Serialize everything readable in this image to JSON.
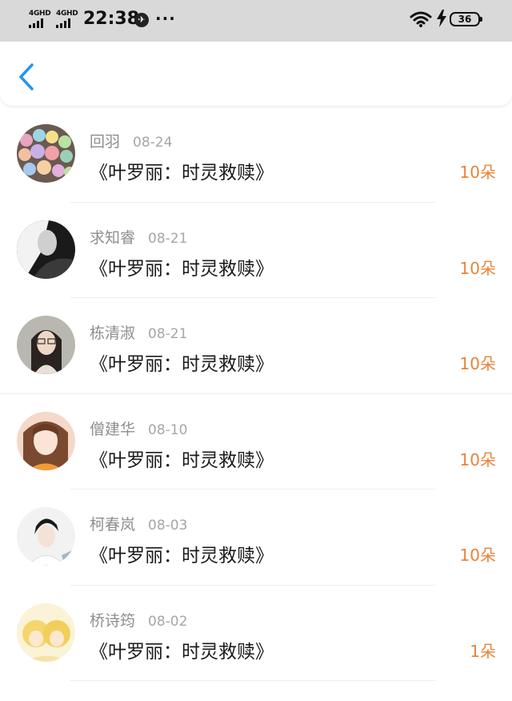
{
  "status_bar": {
    "network_1": "4GHD",
    "network_2": "4GHD",
    "time": "22:38",
    "more": "···",
    "battery": "36"
  },
  "records": [
    {
      "name": "回羽",
      "date": "08-24",
      "title": "《叶罗丽：时灵救赎》",
      "amount": "10朵"
    },
    {
      "name": "求知睿",
      "date": "08-21",
      "title": "《叶罗丽：时灵救赎》",
      "amount": "10朵"
    },
    {
      "name": "栋清淑",
      "date": "08-21",
      "title": "《叶罗丽：时灵救赎》",
      "amount": "10朵"
    },
    {
      "name": "僧建华",
      "date": "08-10",
      "title": "《叶罗丽：时灵救赎》",
      "amount": "10朵"
    },
    {
      "name": "柯春岚",
      "date": "08-03",
      "title": "《叶罗丽：时灵救赎》",
      "amount": "10朵"
    },
    {
      "name": "桥诗筠",
      "date": "08-02",
      "title": "《叶罗丽：时灵救赎》",
      "amount": "1朵"
    }
  ],
  "colors": {
    "accent": "#2196F3",
    "amount": "#e8833a"
  }
}
